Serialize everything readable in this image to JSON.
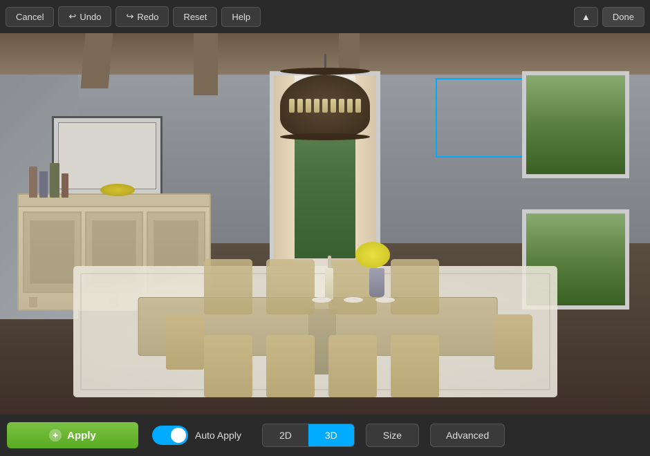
{
  "toolbar": {
    "cancel_label": "Cancel",
    "undo_label": "Undo",
    "redo_label": "Redo",
    "reset_label": "Reset",
    "help_label": "Help",
    "done_label": "Done"
  },
  "bottombar": {
    "apply_label": "Apply",
    "auto_apply_label": "Auto Apply",
    "view_2d_label": "2D",
    "view_3d_label": "3D",
    "size_label": "Size",
    "advanced_label": "Advanced"
  },
  "scene": {
    "room_description": "Dining room 3D view"
  }
}
